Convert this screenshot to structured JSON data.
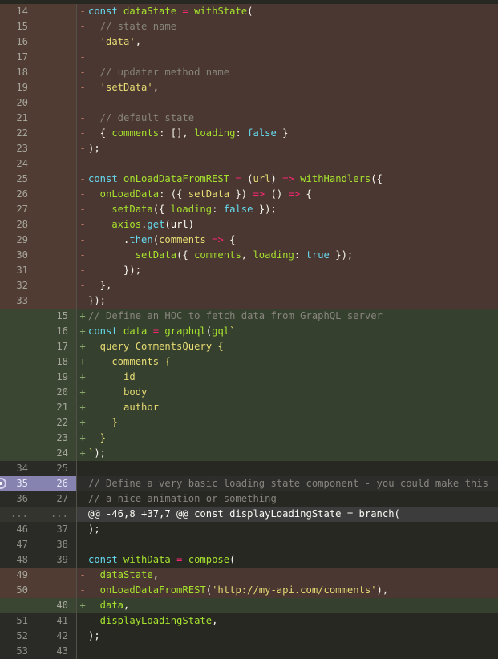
{
  "diff": {
    "rows": [
      {
        "type": "del",
        "old": "14",
        "new": "",
        "sign": "-",
        "tokens": [
          [
            "t-k",
            "const "
          ],
          [
            "t-f",
            "dataState"
          ],
          [
            "t-o",
            " = "
          ],
          [
            "t-f",
            "withState"
          ],
          [
            "t-p",
            "("
          ]
        ]
      },
      {
        "type": "del",
        "old": "15",
        "new": "",
        "sign": "-",
        "tokens": [
          [
            "t-c",
            "  // state name"
          ]
        ]
      },
      {
        "type": "del",
        "old": "16",
        "new": "",
        "sign": "-",
        "tokens": [
          [
            "t-s",
            "  'data'"
          ],
          [
            "t-p",
            ","
          ]
        ]
      },
      {
        "type": "del",
        "old": "17",
        "new": "",
        "sign": "-",
        "tokens": []
      },
      {
        "type": "del",
        "old": "18",
        "new": "",
        "sign": "-",
        "tokens": [
          [
            "t-c",
            "  // updater method name"
          ]
        ]
      },
      {
        "type": "del",
        "old": "19",
        "new": "",
        "sign": "-",
        "tokens": [
          [
            "t-s",
            "  'setData'"
          ],
          [
            "t-p",
            ","
          ]
        ]
      },
      {
        "type": "del",
        "old": "20",
        "new": "",
        "sign": "-",
        "tokens": []
      },
      {
        "type": "del",
        "old": "21",
        "new": "",
        "sign": "-",
        "tokens": [
          [
            "t-c",
            "  // default state"
          ]
        ]
      },
      {
        "type": "del",
        "old": "22",
        "new": "",
        "sign": "-",
        "tokens": [
          [
            "t-p",
            "  { "
          ],
          [
            "t-f",
            "comments"
          ],
          [
            "t-p",
            ": [], "
          ],
          [
            "t-f",
            "loading"
          ],
          [
            "t-p",
            ": "
          ],
          [
            "t-k",
            "false"
          ],
          [
            "t-p",
            " }"
          ]
        ]
      },
      {
        "type": "del",
        "old": "23",
        "new": "",
        "sign": "-",
        "tokens": [
          [
            "t-p",
            ");"
          ]
        ]
      },
      {
        "type": "del",
        "old": "24",
        "new": "",
        "sign": "-",
        "tokens": []
      },
      {
        "type": "del",
        "old": "25",
        "new": "",
        "sign": "-",
        "tokens": [
          [
            "t-k",
            "const "
          ],
          [
            "t-f",
            "onLoadDataFromREST"
          ],
          [
            "t-o",
            " = "
          ],
          [
            "t-p",
            "("
          ],
          [
            "t-y",
            "url"
          ],
          [
            "t-p",
            ") "
          ],
          [
            "t-o",
            "=>"
          ],
          [
            "t-p",
            " "
          ],
          [
            "t-f",
            "withHandlers"
          ],
          [
            "t-p",
            "({"
          ]
        ]
      },
      {
        "type": "del",
        "old": "26",
        "new": "",
        "sign": "-",
        "tokens": [
          [
            "t-f",
            "  onLoadData"
          ],
          [
            "t-p",
            ": ({ "
          ],
          [
            "t-y",
            "setData"
          ],
          [
            "t-p",
            " }) "
          ],
          [
            "t-o",
            "=>"
          ],
          [
            "t-p",
            " () "
          ],
          [
            "t-o",
            "=>"
          ],
          [
            "t-p",
            " {"
          ]
        ]
      },
      {
        "type": "del",
        "old": "27",
        "new": "",
        "sign": "-",
        "tokens": [
          [
            "t-f",
            "    setData"
          ],
          [
            "t-p",
            "({ "
          ],
          [
            "t-f",
            "loading"
          ],
          [
            "t-p",
            ": "
          ],
          [
            "t-k",
            "false"
          ],
          [
            "t-p",
            " });"
          ]
        ]
      },
      {
        "type": "del",
        "old": "28",
        "new": "",
        "sign": "-",
        "tokens": [
          [
            "t-f",
            "    axios"
          ],
          [
            "t-p",
            "."
          ],
          [
            "t-k",
            "get"
          ],
          [
            "t-p",
            "(url)"
          ]
        ]
      },
      {
        "type": "del",
        "old": "29",
        "new": "",
        "sign": "-",
        "tokens": [
          [
            "t-p",
            "      ."
          ],
          [
            "t-k",
            "then"
          ],
          [
            "t-p",
            "("
          ],
          [
            "t-y",
            "comments"
          ],
          [
            "t-p",
            " "
          ],
          [
            "t-o",
            "=>"
          ],
          [
            "t-p",
            " {"
          ]
        ]
      },
      {
        "type": "del",
        "old": "30",
        "new": "",
        "sign": "-",
        "tokens": [
          [
            "t-f",
            "        setData"
          ],
          [
            "t-p",
            "({ "
          ],
          [
            "t-f",
            "comments"
          ],
          [
            "t-p",
            ", "
          ],
          [
            "t-f",
            "loading"
          ],
          [
            "t-p",
            ": "
          ],
          [
            "t-k",
            "true"
          ],
          [
            "t-p",
            " });"
          ]
        ]
      },
      {
        "type": "del",
        "old": "31",
        "new": "",
        "sign": "-",
        "tokens": [
          [
            "t-p",
            "      });"
          ]
        ]
      },
      {
        "type": "del",
        "old": "32",
        "new": "",
        "sign": "-",
        "tokens": [
          [
            "t-p",
            "  },"
          ]
        ]
      },
      {
        "type": "del",
        "old": "33",
        "new": "",
        "sign": "-",
        "tokens": [
          [
            "t-p",
            "});"
          ]
        ]
      },
      {
        "type": "add",
        "old": "",
        "new": "15",
        "sign": "+",
        "tokens": [
          [
            "t-c",
            "// Define an HOC to fetch data from GraphQL server"
          ]
        ]
      },
      {
        "type": "add",
        "old": "",
        "new": "16",
        "sign": "+",
        "tokens": [
          [
            "t-k",
            "const "
          ],
          [
            "t-f",
            "data"
          ],
          [
            "t-o",
            " = "
          ],
          [
            "t-f",
            "graphql"
          ],
          [
            "t-p",
            "("
          ],
          [
            "t-f",
            "gql"
          ],
          [
            "t-s",
            "`"
          ]
        ]
      },
      {
        "type": "add",
        "old": "",
        "new": "17",
        "sign": "+",
        "tokens": [
          [
            "t-s",
            "  query CommentsQuery {"
          ]
        ]
      },
      {
        "type": "add",
        "old": "",
        "new": "18",
        "sign": "+",
        "tokens": [
          [
            "t-s",
            "    comments {"
          ]
        ]
      },
      {
        "type": "add",
        "old": "",
        "new": "19",
        "sign": "+",
        "tokens": [
          [
            "t-s",
            "      id"
          ]
        ]
      },
      {
        "type": "add",
        "old": "",
        "new": "20",
        "sign": "+",
        "tokens": [
          [
            "t-s",
            "      body"
          ]
        ]
      },
      {
        "type": "add",
        "old": "",
        "new": "21",
        "sign": "+",
        "tokens": [
          [
            "t-s",
            "      author"
          ]
        ]
      },
      {
        "type": "add",
        "old": "",
        "new": "22",
        "sign": "+",
        "tokens": [
          [
            "t-s",
            "    }"
          ]
        ]
      },
      {
        "type": "add",
        "old": "",
        "new": "23",
        "sign": "+",
        "tokens": [
          [
            "t-s",
            "  }"
          ]
        ]
      },
      {
        "type": "add",
        "old": "",
        "new": "24",
        "sign": "+",
        "tokens": [
          [
            "t-s",
            "`"
          ],
          [
            "t-p",
            ");"
          ]
        ]
      },
      {
        "type": "ctx",
        "old": "34",
        "new": "25",
        "sign": " ",
        "tokens": []
      },
      {
        "type": "sel",
        "old": "35",
        "new": "26",
        "sign": " ",
        "tokens": [
          [
            "t-c",
            "// Define a very basic loading state component - you could make this"
          ]
        ]
      },
      {
        "type": "ctx",
        "old": "36",
        "new": "27",
        "sign": " ",
        "tokens": [
          [
            "t-c",
            "// a nice animation or something"
          ]
        ]
      },
      {
        "type": "hunk",
        "old": "...",
        "new": "...",
        "sign": "",
        "tokens": [
          [
            "t-p",
            "@@ -46,8 +37,7 @@ const displayLoadingState = branch("
          ]
        ]
      },
      {
        "type": "ctx",
        "old": "46",
        "new": "37",
        "sign": " ",
        "tokens": [
          [
            "t-p",
            ");"
          ]
        ]
      },
      {
        "type": "ctx",
        "old": "47",
        "new": "38",
        "sign": " ",
        "tokens": []
      },
      {
        "type": "ctx",
        "old": "48",
        "new": "39",
        "sign": " ",
        "tokens": [
          [
            "t-k",
            "const "
          ],
          [
            "t-f",
            "withData"
          ],
          [
            "t-o",
            " = "
          ],
          [
            "t-f",
            "compose"
          ],
          [
            "t-p",
            "("
          ]
        ]
      },
      {
        "type": "del",
        "old": "49",
        "new": "",
        "sign": "-",
        "tokens": [
          [
            "t-f",
            "  dataState"
          ],
          [
            "t-p",
            ","
          ]
        ]
      },
      {
        "type": "del",
        "old": "50",
        "new": "",
        "sign": "-",
        "tokens": [
          [
            "t-f",
            "  onLoadDataFromREST"
          ],
          [
            "t-p",
            "("
          ],
          [
            "t-s",
            "'http://my-api.com/comments'"
          ],
          [
            "t-p",
            "),"
          ]
        ]
      },
      {
        "type": "add",
        "old": "",
        "new": "40",
        "sign": "+",
        "tokens": [
          [
            "t-f",
            "  data"
          ],
          [
            "t-p",
            ","
          ]
        ]
      },
      {
        "type": "ctx",
        "old": "51",
        "new": "41",
        "sign": " ",
        "tokens": [
          [
            "t-f",
            "  displayLoadingState"
          ],
          [
            "t-p",
            ","
          ]
        ]
      },
      {
        "type": "ctx",
        "old": "52",
        "new": "42",
        "sign": " ",
        "tokens": [
          [
            "t-p",
            ");"
          ]
        ]
      },
      {
        "type": "ctx",
        "old": "53",
        "new": "43",
        "sign": " ",
        "tokens": []
      }
    ]
  }
}
